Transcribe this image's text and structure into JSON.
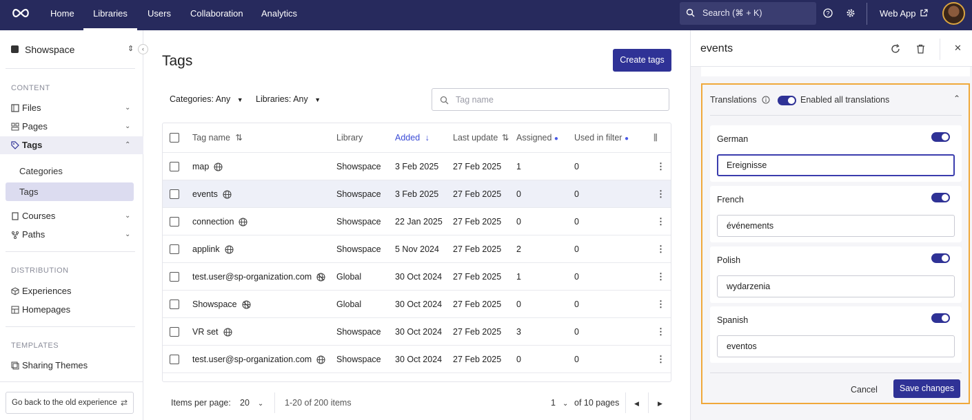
{
  "topbar": {
    "nav": [
      "Home",
      "Libraries",
      "Users",
      "Collaboration",
      "Analytics"
    ],
    "active_nav": "Libraries",
    "search_label": "Search (⌘ + K)",
    "web_app_label": "Web App"
  },
  "sidebar": {
    "workspace": "Showspace",
    "content_label": "CONTENT",
    "items": {
      "files": "Files",
      "pages": "Pages",
      "tags": "Tags",
      "categories": "Categories",
      "tags_sub": "Tags",
      "courses": "Courses",
      "paths": "Paths"
    },
    "distribution_label": "DISTRIBUTION",
    "experiences": "Experiences",
    "homepages": "Homepages",
    "templates_label": "TEMPLATES",
    "sharing_themes": "Sharing Themes",
    "go_back": "Go back to the old experience"
  },
  "main": {
    "title": "Tags",
    "create_button": "Create tags",
    "filters": {
      "categories": "Categories: Any",
      "libraries": "Libraries: Any"
    },
    "search_placeholder": "Tag name",
    "columns": {
      "tag_name": "Tag name",
      "library": "Library",
      "added": "Added",
      "last_update": "Last update",
      "assigned": "Assigned",
      "used_in_filter": "Used in filter"
    },
    "rows": [
      {
        "name": "map",
        "icon": "globe-icon",
        "library": "Showspace",
        "added": "3 Feb 2025",
        "updated": "27 Feb 2025",
        "assigned": "1",
        "used": "0"
      },
      {
        "name": "events",
        "icon": "globe-icon",
        "library": "Showspace",
        "added": "3 Feb 2025",
        "updated": "27 Feb 2025",
        "assigned": "0",
        "used": "0"
      },
      {
        "name": "connection",
        "icon": "globe-icon",
        "library": "Showspace",
        "added": "22 Jan 2025",
        "updated": "27 Feb 2025",
        "assigned": "0",
        "used": "0"
      },
      {
        "name": "applink",
        "icon": "globe-icon",
        "library": "Showspace",
        "added": "5 Nov 2024",
        "updated": "27 Feb 2025",
        "assigned": "2",
        "used": "0"
      },
      {
        "name": "test.user@sp-organization.com",
        "icon": "globe-off-icon",
        "library": "Global",
        "added": "30 Oct 2024",
        "updated": "27 Feb 2025",
        "assigned": "1",
        "used": "0"
      },
      {
        "name": "Showspace",
        "icon": "globe-off-icon",
        "library": "Global",
        "added": "30 Oct 2024",
        "updated": "27 Feb 2025",
        "assigned": "0",
        "used": "0"
      },
      {
        "name": "VR set",
        "icon": "globe-icon",
        "library": "Showspace",
        "added": "30 Oct 2024",
        "updated": "27 Feb 2025",
        "assigned": "3",
        "used": "0"
      },
      {
        "name": "test.user@sp-organization.com",
        "icon": "globe-icon",
        "library": "Showspace",
        "added": "30 Oct 2024",
        "updated": "27 Feb 2025",
        "assigned": "0",
        "used": "0"
      }
    ],
    "pagination": {
      "items_per_page_label": "Items per page:",
      "items_per_page": "20",
      "range": "1-20 of 200 items",
      "page": "1",
      "of_pages": "of 10 pages"
    }
  },
  "panel": {
    "title": "events",
    "translations_label": "Translations",
    "enabled_all_label": "Enabled all translations",
    "translations": [
      {
        "language": "German",
        "value": "Ereignisse"
      },
      {
        "language": "French",
        "value": "événements"
      },
      {
        "language": "Polish",
        "value": "wydarzenia"
      },
      {
        "language": "Spanish",
        "value": "eventos"
      }
    ],
    "cancel": "Cancel",
    "save": "Save changes"
  },
  "colors": {
    "topbar": "#272a5d",
    "primary": "#2f3296",
    "highlight": "#f0a83a",
    "dot": "#4b5be6"
  }
}
